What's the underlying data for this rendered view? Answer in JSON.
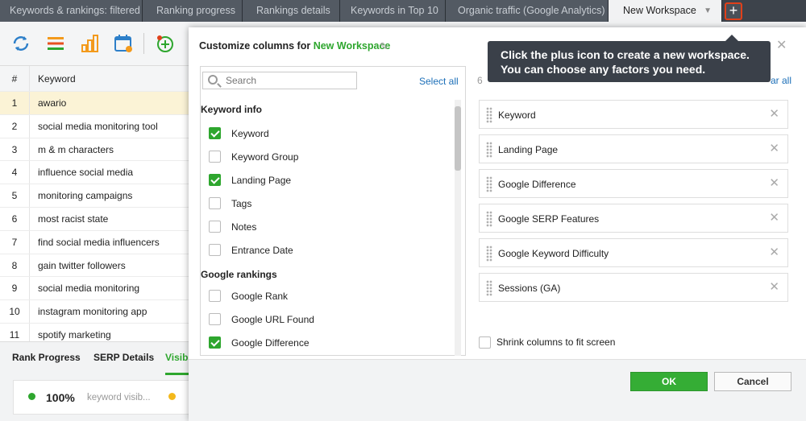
{
  "tabs": [
    {
      "label": "Keywords & rankings: filtered",
      "active": false
    },
    {
      "label": "Ranking progress",
      "active": false
    },
    {
      "label": "Rankings details",
      "active": false
    },
    {
      "label": "Keywords in Top 10",
      "active": false
    },
    {
      "label": "Organic traffic (Google Analytics)",
      "active": false
    },
    {
      "label": "New Workspace",
      "active": true
    }
  ],
  "add_tab_glyph": "+",
  "table": {
    "headers": {
      "num": "#",
      "keyword": "Keyword"
    },
    "rows": [
      {
        "num": "1",
        "keyword": "awario"
      },
      {
        "num": "2",
        "keyword": "social media monitoring tool"
      },
      {
        "num": "3",
        "keyword": "m & m characters"
      },
      {
        "num": "4",
        "keyword": "influence social media"
      },
      {
        "num": "5",
        "keyword": "monitoring campaigns"
      },
      {
        "num": "6",
        "keyword": "most racist state"
      },
      {
        "num": "7",
        "keyword": "find social media influencers"
      },
      {
        "num": "8",
        "keyword": "gain twitter followers"
      },
      {
        "num": "9",
        "keyword": "social media monitoring"
      },
      {
        "num": "10",
        "keyword": "instagram monitoring app"
      },
      {
        "num": "11",
        "keyword": "spotify marketing"
      }
    ]
  },
  "bottom_tabs": {
    "rank_progress": "Rank Progress",
    "serp_details": "SERP Details",
    "visibility": "Visibi"
  },
  "summary": {
    "percent": "100%",
    "label": "keyword visib..."
  },
  "dialog": {
    "title_prefix": "Customize columns for",
    "workspace_name": "New Workspace",
    "search_placeholder": "Search",
    "select_all": "Select all",
    "groups": {
      "keyword_info": "Keyword info",
      "google_rankings": "Google rankings"
    },
    "options": [
      {
        "label": "Keyword",
        "checked": true
      },
      {
        "label": "Keyword Group",
        "checked": false
      },
      {
        "label": "Landing Page",
        "checked": true
      },
      {
        "label": "Tags",
        "checked": false
      },
      {
        "label": "Notes",
        "checked": false
      },
      {
        "label": "Entrance Date",
        "checked": false
      },
      {
        "label": "Google Rank",
        "checked": false
      },
      {
        "label": "Google URL Found",
        "checked": false
      },
      {
        "label": "Google Difference",
        "checked": true
      }
    ],
    "selected_count": "6",
    "clear_all": "ar all",
    "selected_columns": [
      "Keyword",
      "Landing Page",
      "Google Difference",
      "Google SERP Features",
      "Google Keyword Difficulty",
      "Sessions (GA)"
    ],
    "shrink_label": "Shrink columns to fit screen",
    "ok": "OK",
    "cancel": "Cancel"
  },
  "tooltip": {
    "line1": "Click the plus icon to create a new workspace.",
    "line2": "You can choose any factors you need."
  },
  "colors": {
    "accent_green": "#2ea62e",
    "tooltip_bg": "#3a4049",
    "highlight_red": "#e0401a"
  }
}
